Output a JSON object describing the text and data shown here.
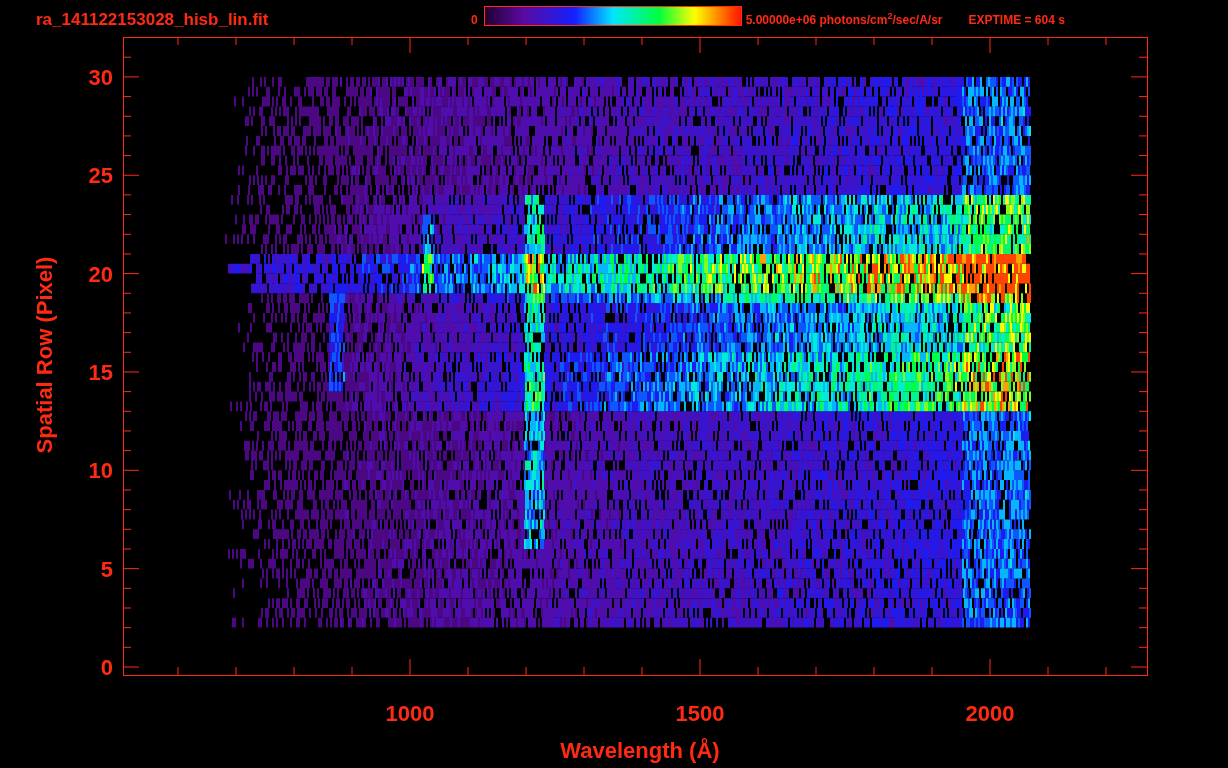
{
  "header": {
    "title": "ra_141122153028_hisb_lin.fit",
    "colorbar": {
      "min_label": "0",
      "max_label": "5.00000e+06 photons/cm$^{2}$/sec/A/sr"
    },
    "exposure": "EXPTIME = 604 s"
  },
  "plot": {
    "y_axis": {
      "label": "Spatial Row (Pixel)",
      "ticks": [
        "30",
        "25",
        "20",
        "15",
        "10",
        "5",
        "0"
      ]
    },
    "x_axis": {
      "label": "Wavelength (Å)",
      "ticks": [
        "1000",
        "1500",
        "2000"
      ]
    }
  }
}
